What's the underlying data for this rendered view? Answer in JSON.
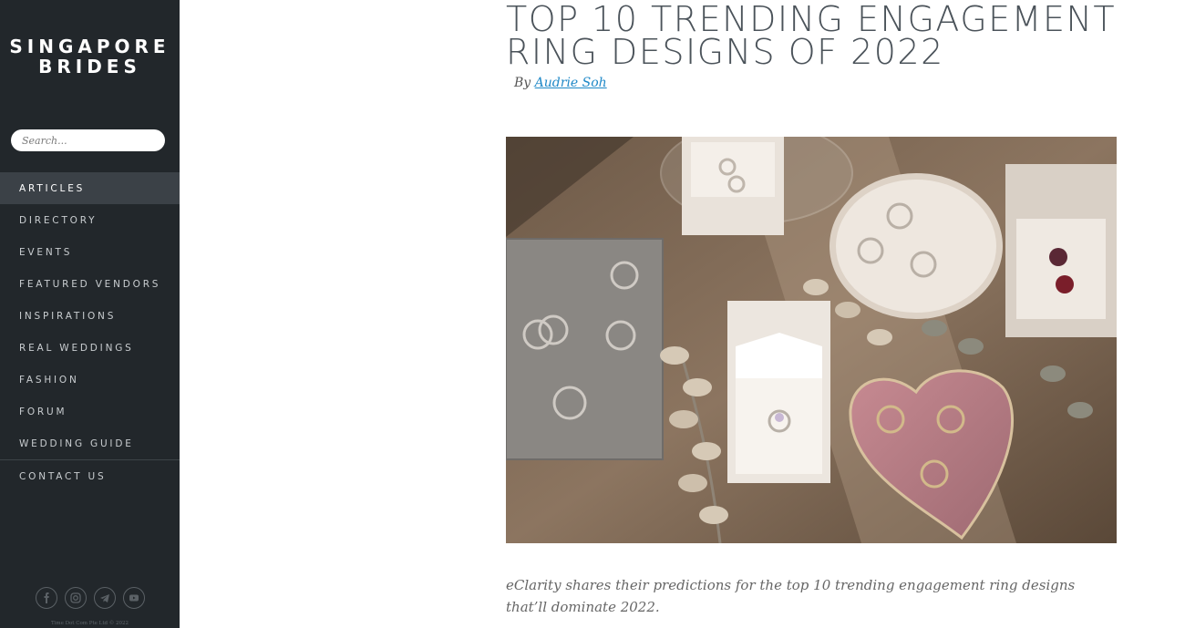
{
  "sidebar": {
    "logo_line1": "SINGAPORE",
    "logo_line2": "BRIDES",
    "search_placeholder": "Search...",
    "nav": [
      {
        "label": "ARTICLES",
        "active": true
      },
      {
        "label": "DIRECTORY"
      },
      {
        "label": "EVENTS"
      },
      {
        "label": "FEATURED VENDORS"
      },
      {
        "label": "INSPIRATIONS"
      },
      {
        "label": "REAL WEDDINGS"
      },
      {
        "label": "FASHION"
      },
      {
        "label": "FORUM"
      },
      {
        "label": "WEDDING GUIDE"
      },
      {
        "label": "CONTACT US"
      }
    ],
    "social_icons": [
      "facebook-icon",
      "instagram-icon",
      "telegram-icon",
      "youtube-icon"
    ],
    "copyright": "Time Dot Com Pte Ltd © 2022"
  },
  "article": {
    "title_line1": "TOP 10 TRENDING ENGAGEMENT",
    "title_line2": "RING DESIGNS OF 2022",
    "byline_prefix": "By",
    "author": "Audrie Soh",
    "excerpt": "eClarity shares their predictions for the top 10 trending engagement ring designs that’ll dominate 2022."
  },
  "colors": {
    "sidebar_bg": "#22272b",
    "active_nav_bg": "#3b4147",
    "title": "#4b535a",
    "link": "#1e88c7"
  }
}
